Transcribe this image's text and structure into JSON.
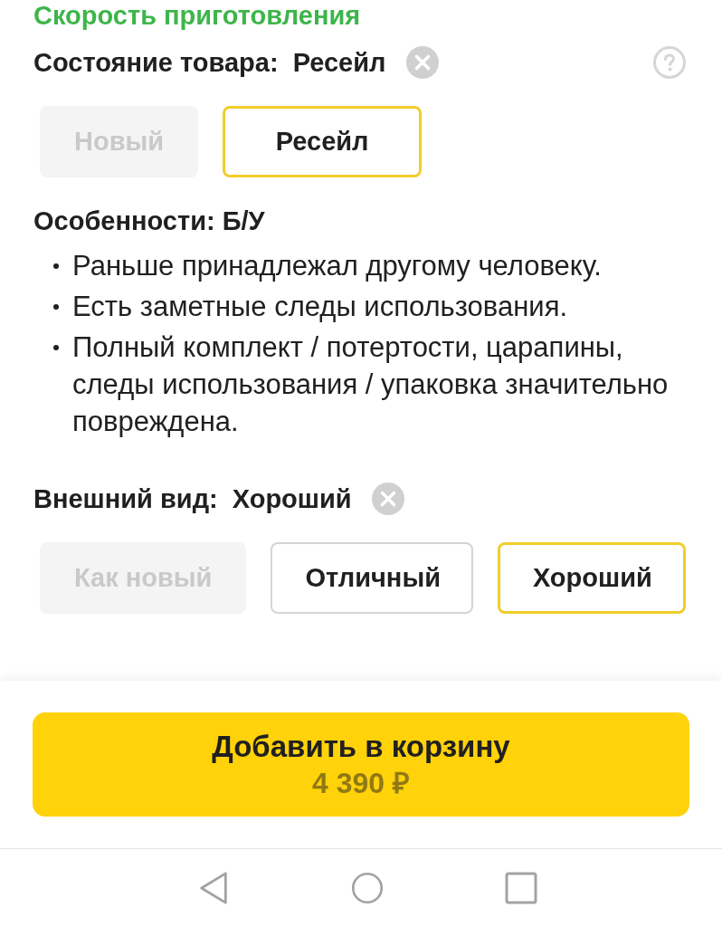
{
  "header": {
    "text": "Скорость приготовления"
  },
  "sections": [
    {
      "label": "Состояние товара:",
      "value": "Ресейл",
      "help": true,
      "options": [
        {
          "label": "Новый",
          "selected": false,
          "disabled": true
        },
        {
          "label": "Ресейл",
          "selected": true,
          "disabled": false
        }
      ],
      "features": {
        "title": "Особенности: Б/У",
        "items": [
          "Раньше принадлежал другому человеку.",
          "Есть заметные следы использования.",
          "Полный комплект / потертости, царапины, следы использования / упаковка значительно повреждена."
        ]
      }
    },
    {
      "label": "Внешний вид:",
      "value": "Хороший",
      "options": [
        {
          "label": "Как новый",
          "selected": false,
          "disabled": true
        },
        {
          "label": "Отличный",
          "selected": false,
          "disabled": false
        },
        {
          "label": "Хороший",
          "selected": true,
          "disabled": false
        }
      ]
    }
  ],
  "cart_button": {
    "label": "Добавить в корзину",
    "price": "4 390 ₽"
  }
}
